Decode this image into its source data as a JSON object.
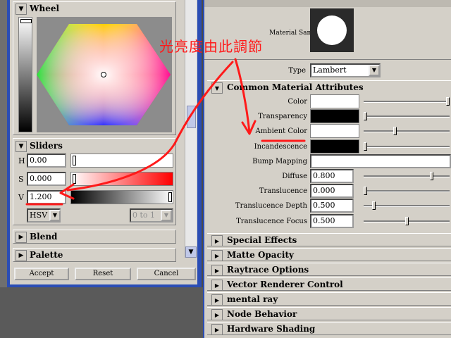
{
  "color_chooser": {
    "wheel": {
      "title": "Wheel"
    },
    "sliders": {
      "title": "Sliders",
      "h": {
        "label": "H",
        "value": "0.00"
      },
      "s": {
        "label": "S",
        "value": "0.000"
      },
      "v": {
        "label": "V",
        "value": "1.200"
      },
      "mode": "HSV",
      "range": "0 to 1"
    },
    "blend": {
      "title": "Blend"
    },
    "palette": {
      "title": "Palette"
    },
    "buttons": {
      "accept": "Accept",
      "reset": "Reset",
      "cancel": "Cancel"
    }
  },
  "annotation": {
    "text": "光亮度由此調節",
    "color": "#ff1a1a"
  },
  "material": {
    "sample_label": "Material Sample",
    "type_label": "Type",
    "type_value": "Lambert",
    "section_title": "Common Material Attributes",
    "attributes": [
      {
        "label": "Color",
        "kind": "swatch",
        "swatch": "#ffffff",
        "slider": 1.0
      },
      {
        "label": "Transparency",
        "kind": "swatch",
        "swatch": "#000000",
        "slider": 0.0
      },
      {
        "label": "Ambient Color",
        "kind": "swatch",
        "swatch": "#ffffff",
        "slider": 0.36
      },
      {
        "label": "Incandescence",
        "kind": "swatch",
        "swatch": "#000000",
        "slider": 0.0
      },
      {
        "label": "Bump Mapping",
        "kind": "field",
        "value": ""
      },
      {
        "label": "Diffuse",
        "kind": "number",
        "value": "0.800",
        "slider": 0.8
      },
      {
        "label": "Translucence",
        "kind": "number",
        "value": "0.000",
        "slider": 0.0
      },
      {
        "label": "Translucence Depth",
        "kind": "number",
        "value": "0.500",
        "slider": 0.1
      },
      {
        "label": "Translucence Focus",
        "kind": "number",
        "value": "0.500",
        "slider": 0.5
      }
    ],
    "collapsed_sections": [
      "Special Effects",
      "Matte Opacity",
      "Raytrace Options",
      "Vector Renderer Control",
      "mental ray",
      "Node Behavior",
      "Hardware Shading"
    ]
  }
}
